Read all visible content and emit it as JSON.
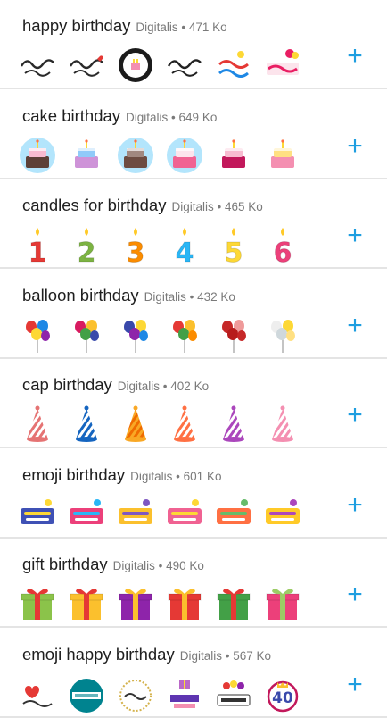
{
  "packs": [
    {
      "name": "happy birthday",
      "meta": "Digitalis • 471 Ko",
      "stickers": [
        "script-birthday-sticker",
        "script-birthday-heart-sticker",
        "round-birthday-badge-sticker",
        "script-birthday-dark-sticker",
        "colorful-happy-birthday-sticker",
        "balloons-birthday-banner-sticker"
      ]
    },
    {
      "name": "cake birthday",
      "meta": "Digitalis • 649 Ko",
      "stickers": [
        "chocolate-cake-sticker",
        "layered-cake-sticker",
        "chocolate-candles-cake-sticker",
        "pink-cake-sticker",
        "magenta-candles-cake-sticker",
        "tall-cake-sticker"
      ]
    },
    {
      "name": "candles for birthday",
      "meta": "Digitalis • 465 Ko",
      "stickers": [
        "candle-1-sticker",
        "candle-2-sticker",
        "candle-3-sticker",
        "candle-4-sticker",
        "candle-5-sticker",
        "candle-6-sticker"
      ]
    },
    {
      "name": "balloon birthday",
      "meta": "Digitalis • 432 Ko",
      "stickers": [
        "balloon-bunch-1-sticker",
        "balloon-bunch-2-sticker",
        "balloon-bunch-3-sticker",
        "balloon-bunch-4-sticker",
        "balloon-bunch-5-sticker",
        "balloon-bunch-6-sticker"
      ]
    },
    {
      "name": "cap birthday",
      "meta": "Digitalis • 402 Ko",
      "stickers": [
        "striped-party-hat-sticker",
        "blue-party-hat-sticker",
        "yellow-party-hat-sticker",
        "orange-party-hat-sticker",
        "purple-party-hat-sticker",
        "pink-party-hat-sticker"
      ]
    },
    {
      "name": "emoji birthday",
      "meta": "Digitalis • 601 Ko",
      "stickers": [
        "happy-birthday-banner-sticker",
        "enjoy-your-day-sticker",
        "its-your-birthday-sticker",
        "lets-party-yay-sticker",
        "birthday-party-sticker",
        "happy-b-day-sticker"
      ]
    },
    {
      "name": "gift birthday",
      "meta": "Digitalis • 490 Ko",
      "stickers": [
        "green-gift-sticker",
        "orange-gift-sticker",
        "purple-gift-sticker",
        "red-gift-sticker",
        "green-red-gift-sticker",
        "pink-gift-sticker"
      ]
    },
    {
      "name": "emoji happy birthday",
      "meta": "Digitalis • 567 Ko",
      "stickers": [
        "happy-birthday-hearts-sticker",
        "teal-birthday-badge-sticker",
        "birthday-wreath-sticker",
        "happy-birthday-gift-sticker",
        "happy-birthday-balloons-sticker",
        "40-birthday-wreath-sticker"
      ]
    }
  ],
  "add_icon": "+"
}
